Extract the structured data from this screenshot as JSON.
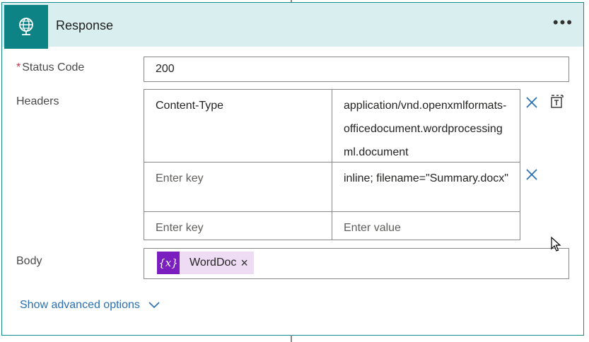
{
  "card": {
    "title": "Response",
    "icon": "globe-response-icon",
    "more_icon": "ellipsis-icon"
  },
  "status_code": {
    "required_marker": "*",
    "label": "Status Code",
    "value": "200"
  },
  "headers": {
    "label": "Headers",
    "rows": [
      {
        "key": "Content-Type",
        "value": "application/vnd.openxmlformats-officedocument.wordprocessingml.document"
      },
      {
        "key": "Enter key",
        "value": "inline; filename=\"Summary.docx\""
      },
      {
        "key": "Enter key",
        "value": "Enter value"
      }
    ]
  },
  "body": {
    "label": "Body",
    "token_icon": "{x}",
    "token_label": "WordDoc",
    "token_close": "×"
  },
  "advanced_options": {
    "label": "Show advanced options",
    "icon": "chevron-down-icon"
  },
  "colors": {
    "accent": "#0e8385",
    "header_bg": "#d9eeef",
    "link": "#2a6fb0",
    "token_icon_bg": "#7a1ec0",
    "token_bg": "#eedcf5",
    "delete_icon": "#2a6fb0"
  }
}
